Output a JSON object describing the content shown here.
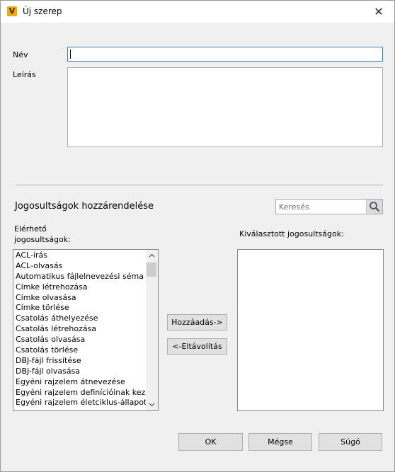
{
  "window": {
    "title": "Új szerep",
    "icon": "vault-app-icon",
    "close": "✕"
  },
  "form": {
    "name_label": "Név",
    "name_value": "",
    "description_label": "Leírás",
    "description_value": ""
  },
  "permissions": {
    "section_title": "Jogosultságok hozzárendelése",
    "search_placeholder": "Keresés",
    "available_label_line1": "Elérhető",
    "available_label_line2": "jogosultságok:",
    "selected_label": "Kiválasztott jogosultságok:",
    "available_items": [
      "ACL-írás",
      "ACL-olvasás",
      "Automatikus fájlelnevezési séma frissítése",
      "Címke létrehozása",
      "Címke olvasása",
      "Címke törlése",
      "Csatolás áthelyezése",
      "Csatolás létrehozása",
      "Csatolás olvasása",
      "Csatolás törlése",
      "DBJ-fájl frissítése",
      "DBJ-fájl olvasása",
      "Egyéni rajzelem átnevezése",
      "Egyéni rajzelem definícióinak kezelése",
      "Egyéni rajzelem életciklus-állapotának módosítása"
    ],
    "add_button": "Hozzáadás->",
    "remove_button": "<-Eltávolítás"
  },
  "footer": {
    "ok": "OK",
    "cancel": "Mégse",
    "help": "Súgó"
  }
}
